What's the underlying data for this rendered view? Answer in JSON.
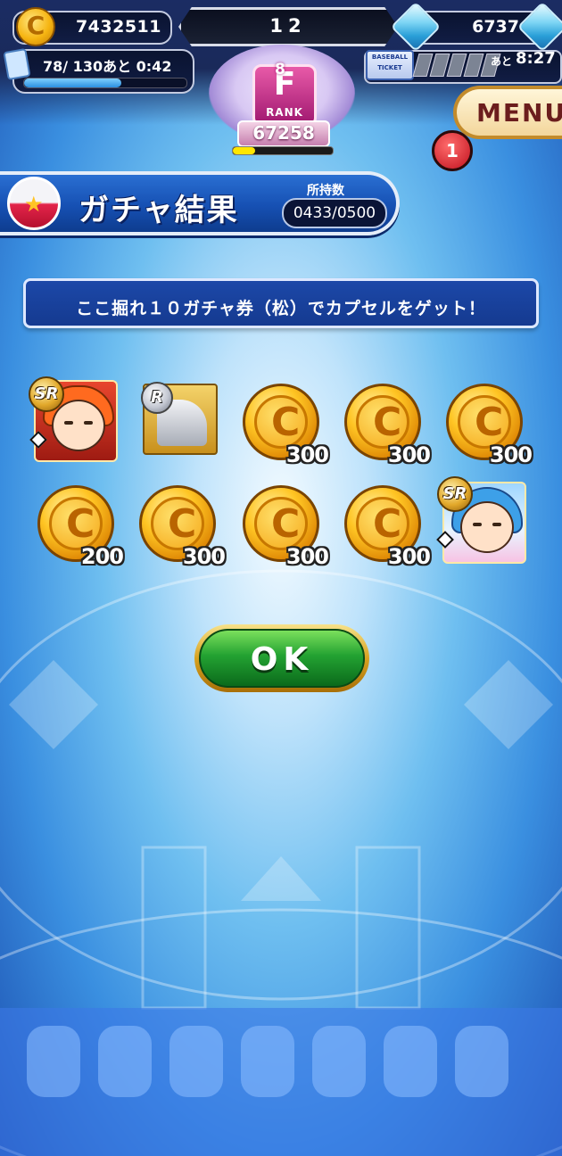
{
  "status_bar": {
    "coins": "7432511",
    "level": "12",
    "gems": "6737",
    "stamina": "78/ 130あと  0:42",
    "stamina_fraction": 0.6,
    "ticket_badge": "BASEBALL TICKET",
    "ticket_slots_filled": 0,
    "ticket_slots_total": 5,
    "ticket_label": "あと",
    "ticket_time": "8:27"
  },
  "rank": {
    "letter": "F",
    "superscript": "8",
    "label": "RANK",
    "score": "67258",
    "progress": 0.22
  },
  "menu": {
    "label": "MENU",
    "notification_count": "1"
  },
  "header": {
    "title": "ガチャ結果",
    "holdings_label": "所持数",
    "holdings_value": "0433/0500"
  },
  "message": "ここ掘れ１０ガチャ券（松）でカプセルをゲット！",
  "results": [
    {
      "type": "character",
      "rarity": "SR",
      "style": "red-hair"
    },
    {
      "type": "item",
      "rarity": "R"
    },
    {
      "type": "coin",
      "amount": "300"
    },
    {
      "type": "coin",
      "amount": "300"
    },
    {
      "type": "coin",
      "amount": "300"
    },
    {
      "type": "coin",
      "amount": "200"
    },
    {
      "type": "coin",
      "amount": "300"
    },
    {
      "type": "coin",
      "amount": "300"
    },
    {
      "type": "coin",
      "amount": "300"
    },
    {
      "type": "character",
      "rarity": "SR",
      "style": "blue-hair"
    }
  ],
  "ok_button": {
    "label": "OK"
  },
  "colors": {
    "accent_blue": "#1650b3",
    "ok_green": "#23a232",
    "coin_gold": "#ffc524"
  }
}
